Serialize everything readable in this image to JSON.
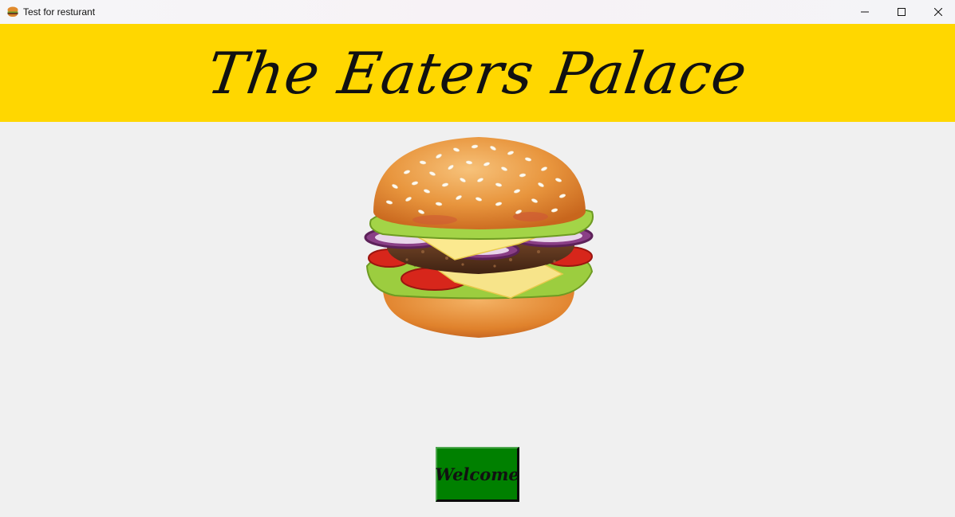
{
  "window": {
    "title": "Test for resturant",
    "icon": "burger-icon",
    "controls": [
      "minimize-icon",
      "maximize-icon",
      "close-icon"
    ]
  },
  "header": {
    "title": "The Eaters Palace",
    "background": "#ffd700"
  },
  "main": {
    "image": "burger-image",
    "welcome_button": {
      "label": "Welcome",
      "background": "#008000"
    }
  },
  "colors": {
    "window_bg": "#f0f0f0",
    "header_bg": "#ffd700",
    "button_bg": "#008000"
  }
}
